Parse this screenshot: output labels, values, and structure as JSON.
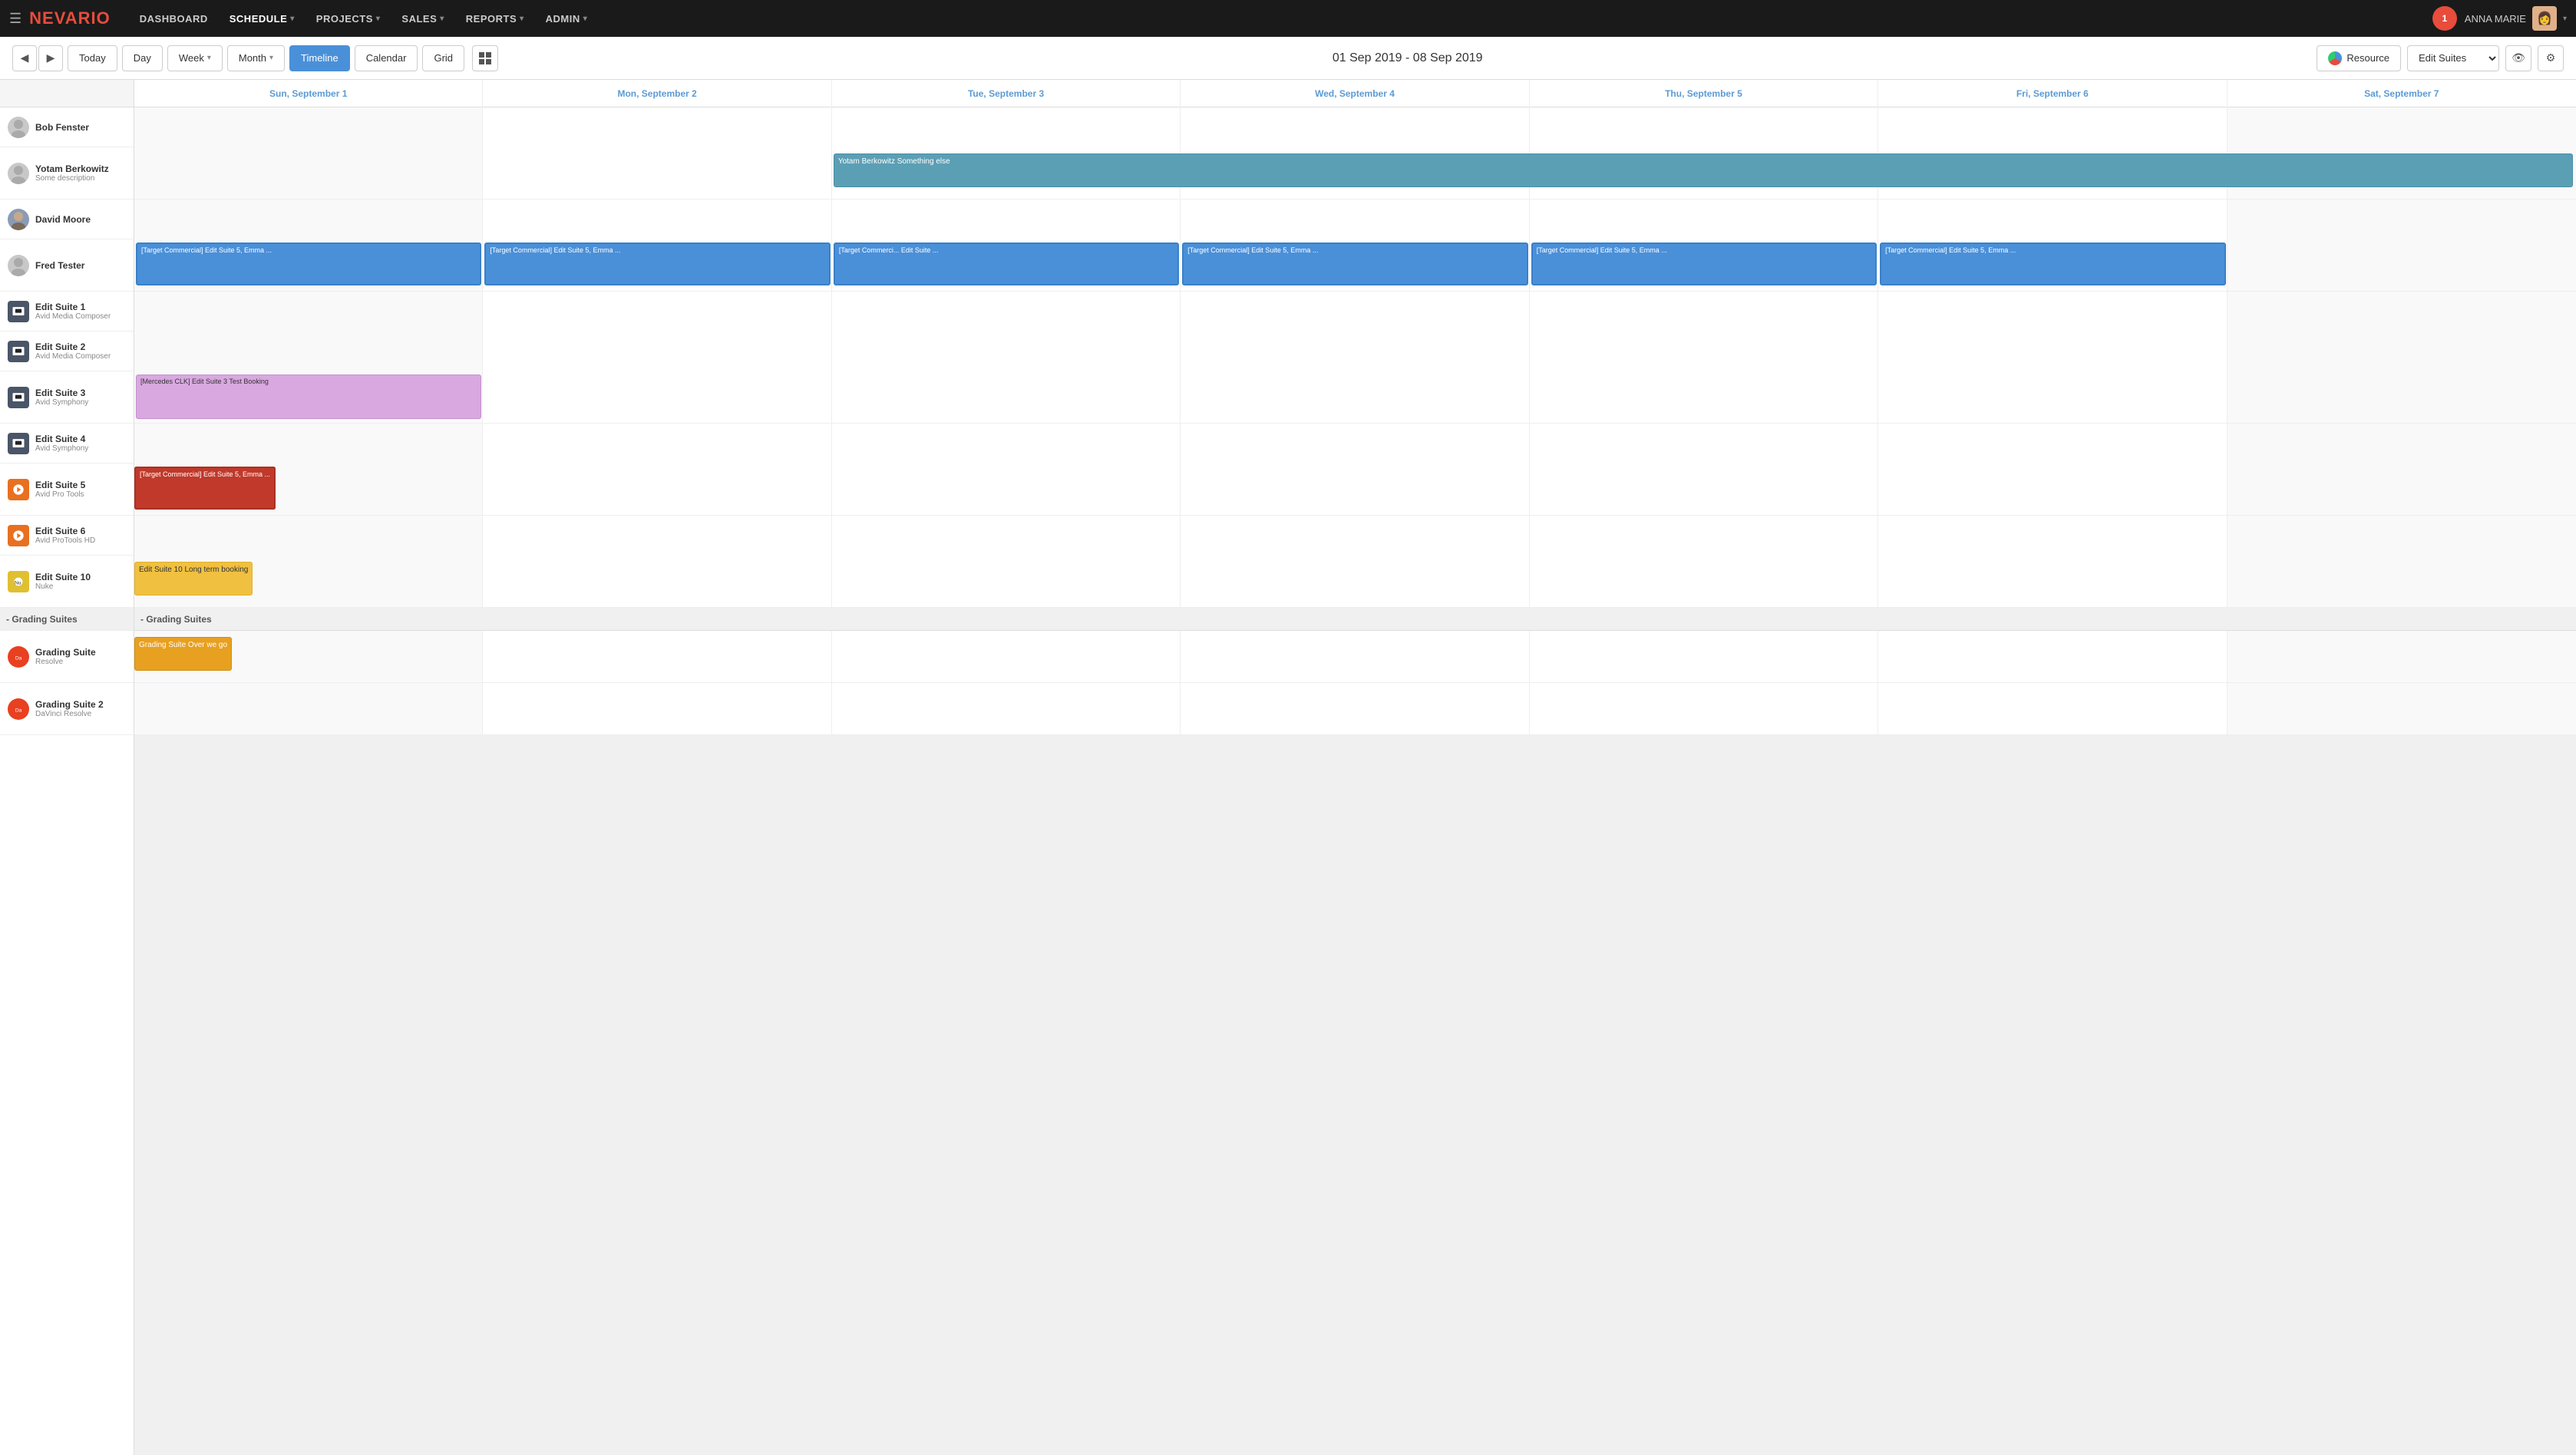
{
  "nav": {
    "logo": "NEVARIO",
    "links": [
      {
        "label": "DASHBOARD",
        "active": false
      },
      {
        "label": "SCHEDULE",
        "active": true,
        "hasCaret": true
      },
      {
        "label": "PROJECTS",
        "active": false,
        "hasCaret": true
      },
      {
        "label": "SALES",
        "active": false,
        "hasCaret": true
      },
      {
        "label": "REPORTS",
        "active": false,
        "hasCaret": true
      },
      {
        "label": "ADMIN",
        "active": false,
        "hasCaret": true
      }
    ],
    "notification_count": "1",
    "user_name": "ANNA MARIE",
    "user_caret": "▾"
  },
  "toolbar": {
    "prev_label": "◀",
    "next_label": "▶",
    "today_label": "Today",
    "day_label": "Day",
    "week_label": "Week",
    "month_label": "Month",
    "timeline_label": "Timeline",
    "calendar_label": "Calendar",
    "grid_label": "Grid",
    "date_range": "01 Sep 2019 - 08 Sep 2019",
    "resource_label": "Resource",
    "suite_select": "Edit Suites",
    "eye_icon": "👁",
    "gear_icon": "⚙"
  },
  "day_headers": [
    "Sun, September 1",
    "Mon, September 2",
    "Tue, September 3",
    "Wed, September 4",
    "Thu, September 5",
    "Fri, September 6",
    "Sat, September 7"
  ],
  "resources": [
    {
      "id": "bob",
      "name": "Bob Fenster",
      "sub": "",
      "type": "person"
    },
    {
      "id": "yotam",
      "name": "Yotam Berkowitz",
      "sub": "Some description",
      "type": "person"
    },
    {
      "id": "david",
      "name": "David Moore",
      "sub": "",
      "type": "person",
      "hasAvatar": true
    },
    {
      "id": "fred",
      "name": "Fred Tester",
      "sub": "",
      "type": "person"
    },
    {
      "id": "suite1",
      "name": "Edit Suite 1",
      "sub": "Avid Media Composer",
      "type": "suite",
      "color": "#555"
    },
    {
      "id": "suite2",
      "name": "Edit Suite 2",
      "sub": "Avid Media Composer",
      "type": "suite",
      "color": "#555"
    },
    {
      "id": "suite3",
      "name": "Edit Suite 3",
      "sub": "Avid Symphony",
      "type": "suite",
      "color": "#555"
    },
    {
      "id": "suite4",
      "name": "Edit Suite 4",
      "sub": "Avid Symphony",
      "type": "suite",
      "color": "#555"
    },
    {
      "id": "suite5",
      "name": "Edit Suite 5",
      "sub": "Avid Pro Tools",
      "type": "suite",
      "color": "#e87020"
    },
    {
      "id": "suite6",
      "name": "Edit Suite 6",
      "sub": "Avid ProTools HD",
      "type": "suite",
      "color": "#555"
    },
    {
      "id": "suite10",
      "name": "Edit Suite 10",
      "sub": "Nuke",
      "type": "suite",
      "color": "#e0b030"
    },
    {
      "id": "grading",
      "name": "Grading Suite",
      "sub": "Resolve",
      "type": "grading",
      "color": "#e84020"
    },
    {
      "id": "grading2",
      "name": "Grading Suite 2",
      "sub": "DaVinci Resolve",
      "type": "grading",
      "color": "#e84020"
    }
  ],
  "grading_section_label": "- Grading Suites",
  "events": {
    "yotam_event": {
      "label": "Yotam Berkowitz Something else",
      "style": "teal",
      "col_start": 2,
      "col_span": 5,
      "row": "yotam"
    },
    "fred_events": [
      {
        "label": "[Target Commercial] Edit Suite 5, Emma ...",
        "style": "blue",
        "col": 0
      },
      {
        "label": "[Target Commercial] Edit Suite 5, Emma ...",
        "style": "blue",
        "col": 1
      },
      {
        "label": "[Target Commerci... Edit Suite ...",
        "style": "blue",
        "col": 2
      },
      {
        "label": "[Target Commercial] Edit Suite 5, Emma ...",
        "style": "blue",
        "col": 3
      },
      {
        "label": "[Target Commercial] Edit Suite 5, Emma ...",
        "style": "blue",
        "col": 4
      },
      {
        "label": "[Target Commercial] Edit Suite 5, Emma ...",
        "style": "blue",
        "col": 5
      }
    ],
    "suite3_event": {
      "label": "[Mercedes CLK] Edit Suite 3 Test Booking",
      "style": "purple",
      "col": 0
    },
    "suite5_events": [
      {
        "label": "[Target Commercial] Edit Suite 5, Emma ...",
        "style": "red",
        "col": 0
      },
      {
        "label": "[Target Commercial] Edit Suite 5, Emma ...",
        "style": "red",
        "col": 1
      },
      {
        "label": "[Target Commerci... Edit Suite ...",
        "style": "red",
        "col": 2
      },
      {
        "label": "[Target Commercial] Edit Suite 5, Emma ...",
        "style": "red",
        "col": 3
      },
      {
        "label": "[Target Commercial] Edit Suite 5, Emma ...",
        "style": "red",
        "col": 4
      },
      {
        "label": "[Target Commercial] Edit Suite 5, Emma ...",
        "style": "red",
        "col": 5
      }
    ],
    "suite10_event": {
      "label": "Edit Suite 10 Long term booking",
      "style": "yellow",
      "col_start": 0,
      "col_span": 6
    },
    "grading_event": {
      "label": "Grading Suite Over we go",
      "style": "orange",
      "col_start": 2,
      "col_span": 2
    }
  }
}
